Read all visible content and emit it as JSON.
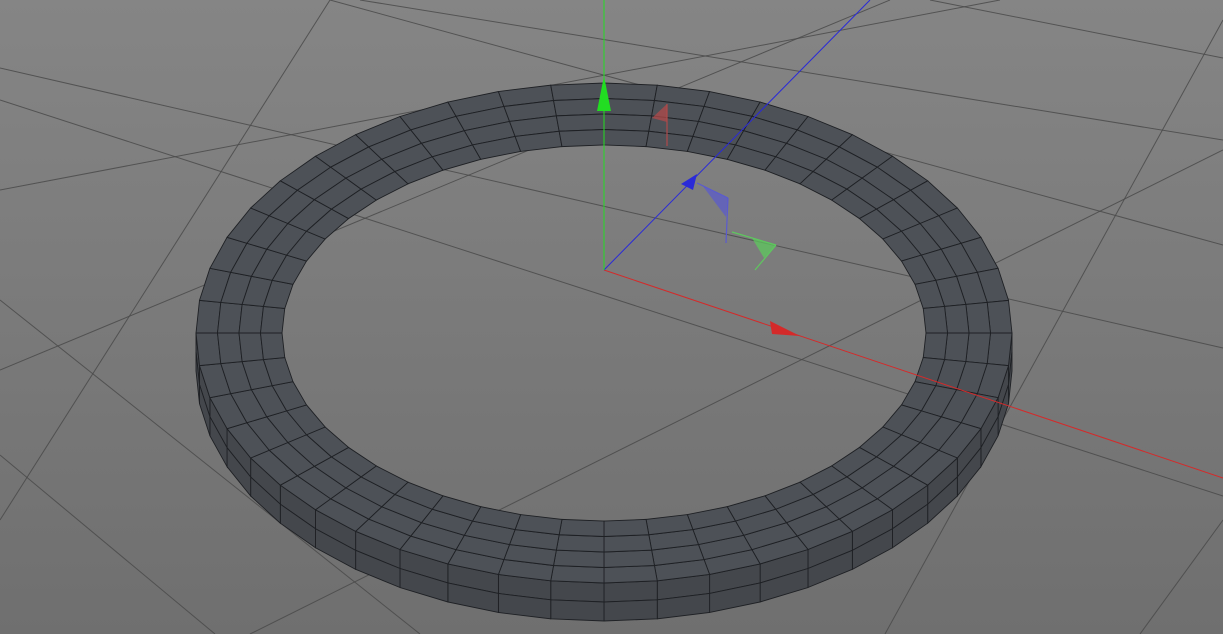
{
  "viewport": {
    "background_top": "#858585",
    "background_bottom": "#6f6f6f",
    "grid_color": "#4a4a4a"
  },
  "axes": {
    "x_color": "#d42a2a",
    "y_color": "#22dd22",
    "z_color": "#2a2ad8"
  },
  "mini_gizmo": {
    "x_color": "#b04a4a",
    "y_color": "#5ec85e",
    "z_color": "#5a5ad0"
  },
  "mesh": {
    "fill_color": "#4d5157",
    "edge_color": "#1e2024",
    "segments": 48,
    "rings": 4
  }
}
